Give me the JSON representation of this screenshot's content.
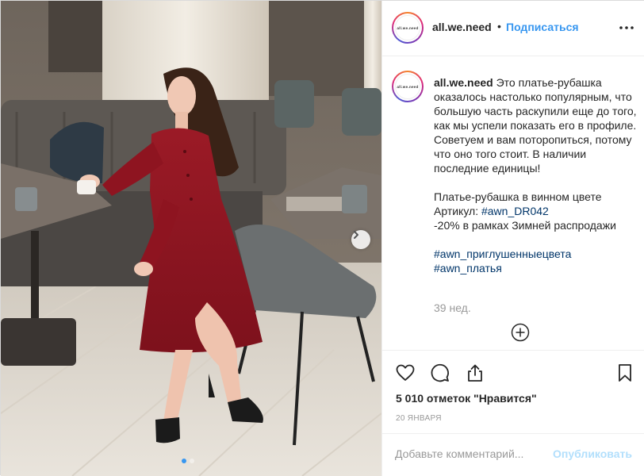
{
  "header": {
    "avatar_text": "all.we.need",
    "username": "all.we.need",
    "separator": "•",
    "follow_label": "Подписаться",
    "more_icon": "more-horizontal-icon"
  },
  "caption": {
    "username": "all.we.need",
    "para1": "Это платье-рубашка оказалось настолько популярным, что большую часть раскупили еще до того, как мы успели показать его в профиле. Советуем и вам поторопиться, потому что оно того стоит. В наличии последние единицы!",
    "para2_line1": "Платье-рубашка в винном цвете",
    "para2_line2_prefix": "Артикул: ",
    "para2_line2_tag": "#awn_DR042",
    "para2_line3": "-20% в рамках Зимней распродажи",
    "hashtag1": "#awn_приглушенныецвета",
    "hashtag2": "#awn_платья"
  },
  "time_ago": "39 нед.",
  "actions": {
    "like_icon": "heart-icon",
    "comment_icon": "comment-icon",
    "share_icon": "share-icon",
    "save_icon": "bookmark-icon"
  },
  "likes_text": "5 010 отметок \"Нравится\"",
  "date_text": "20 ЯНВАРЯ",
  "comment": {
    "placeholder": "Добавьте комментарий...",
    "publish_label": "Опубликовать"
  },
  "carousel": {
    "total": 2,
    "current": 1
  },
  "colors": {
    "link_blue": "#3897f0",
    "hashtag": "#003569",
    "muted": "#999999",
    "dress": "#8e1420"
  }
}
